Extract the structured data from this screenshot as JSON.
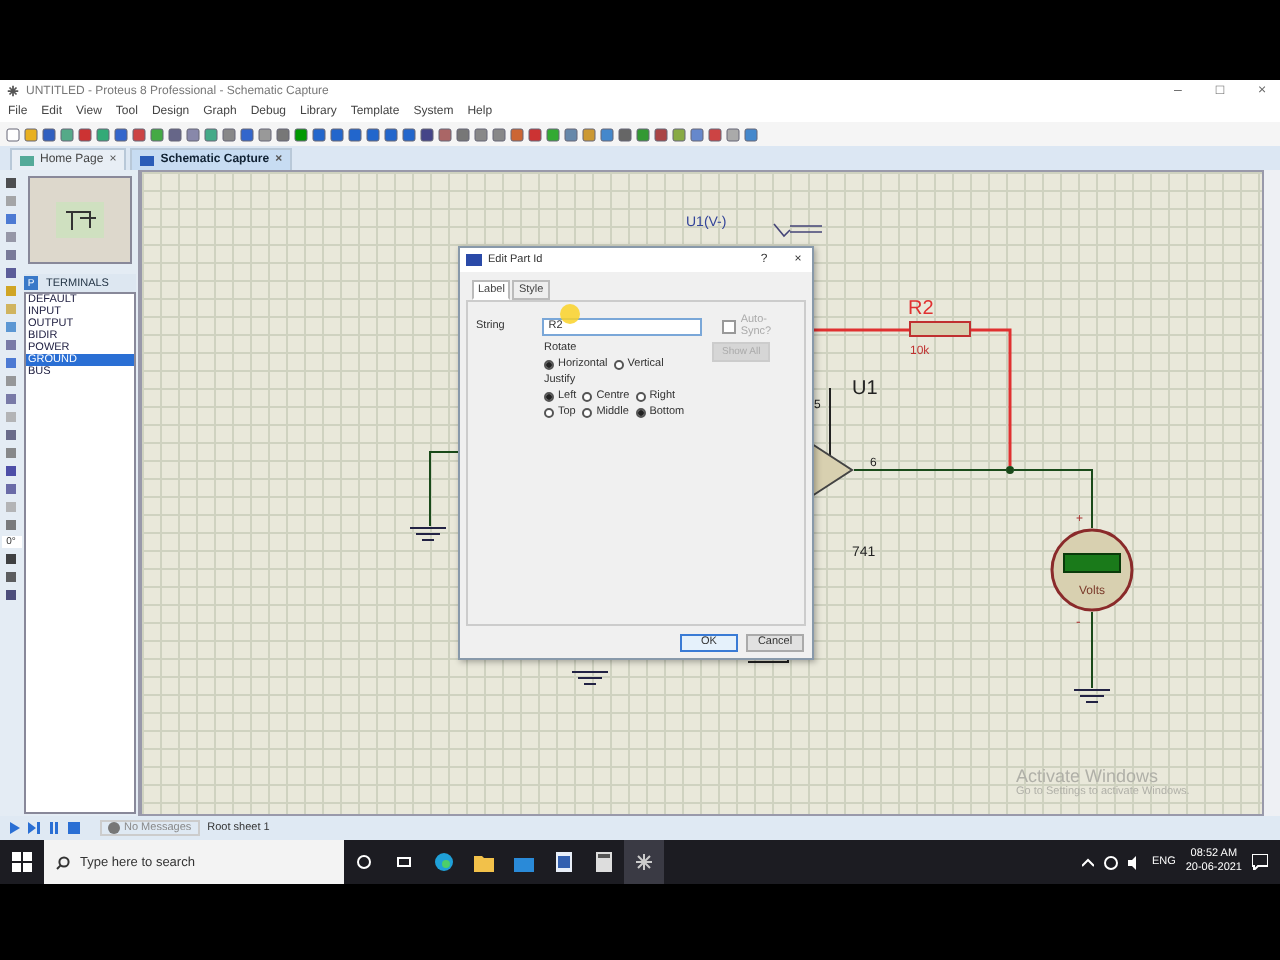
{
  "window": {
    "title": "UNTITLED - Proteus 8 Professional - Schematic Capture",
    "controls": [
      "–",
      "□",
      "×"
    ]
  },
  "menu": [
    "File",
    "Edit",
    "View",
    "Tool",
    "Design",
    "Graph",
    "Debug",
    "Library",
    "Template",
    "System",
    "Help"
  ],
  "tabs": [
    {
      "label": "Home Page",
      "close": "×",
      "selected": false
    },
    {
      "label": "Schematic Capture",
      "close": "×",
      "selected": true
    }
  ],
  "sidebar": {
    "mode_button": "P",
    "header": "TERMINALS",
    "items": [
      {
        "label": "DEFAULT",
        "selected": false
      },
      {
        "label": "INPUT",
        "selected": false
      },
      {
        "label": "OUTPUT",
        "selected": false
      },
      {
        "label": "BIDIR",
        "selected": false
      },
      {
        "label": "POWER",
        "selected": false
      },
      {
        "label": "GROUND",
        "selected": true
      },
      {
        "label": "BUS",
        "selected": false
      }
    ],
    "angle": "0°"
  },
  "schematic": {
    "probe_label": "U1(V-)",
    "resistor": {
      "ref": "R2",
      "value": "10k"
    },
    "opamp": {
      "ref": "U1",
      "type": "741",
      "pins": [
        "5",
        "6"
      ]
    },
    "voltmeter": {
      "unit": "Volts",
      "plus": "+",
      "minus": "-"
    }
  },
  "dialog": {
    "title": "Edit Part Id",
    "help": "?",
    "close": "×",
    "tabs": [
      {
        "label": "Label",
        "selected": true
      },
      {
        "label": "Style",
        "selected": false
      }
    ],
    "string_label": "String",
    "string_value": "R2",
    "auto_sync": {
      "label": "Auto-Sync?",
      "checked": false,
      "disabled": true
    },
    "rotate": {
      "label": "Rotate",
      "options": [
        {
          "label": "Horizontal",
          "selected": true
        },
        {
          "label": "Vertical",
          "selected": false
        }
      ]
    },
    "show_all": {
      "label": "Show All",
      "disabled": true
    },
    "justify": {
      "label": "Justify",
      "options": [
        {
          "label": "Left",
          "selected": true
        },
        {
          "label": "Centre",
          "selected": false
        },
        {
          "label": "Right",
          "selected": false
        },
        {
          "label": "Top",
          "selected": false
        },
        {
          "label": "Middle",
          "selected": false
        },
        {
          "label": "Bottom",
          "selected": true
        }
      ]
    },
    "buttons": [
      "OK",
      "Cancel"
    ]
  },
  "activation_notice": {
    "title": "Activate Windows",
    "text": "Go to Settings to activate Windows."
  },
  "status_bar": {
    "messages": "No Messages",
    "sheet": "Root sheet 1"
  },
  "taskbar": {
    "search_placeholder": "Type here to search",
    "language": "ENG",
    "time": "08:52 AM",
    "date": "20-06-2021"
  }
}
